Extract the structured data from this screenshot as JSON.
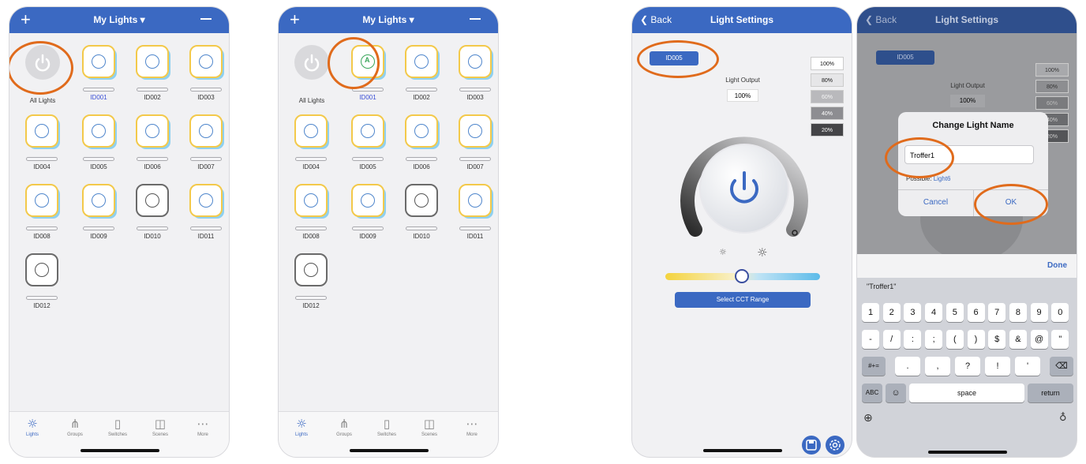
{
  "screens": [
    {
      "title": "My Lights",
      "all_label": "All Lights",
      "tiles": [
        "ID001",
        "ID002",
        "ID003",
        "ID004",
        "ID005",
        "ID006",
        "ID007",
        "ID008",
        "ID009",
        "ID010",
        "ID011",
        "ID012"
      ],
      "tabs": [
        "Lights",
        "Groups",
        "Switches",
        "Scenes",
        "More"
      ]
    },
    {
      "title": "My Lights",
      "all_label": "All Lights",
      "tiles": [
        "ID001",
        "ID002",
        "ID003",
        "ID004",
        "ID005",
        "ID006",
        "ID007",
        "ID008",
        "ID009",
        "ID010",
        "ID011",
        "ID012"
      ],
      "tabs": [
        "Lights",
        "Groups",
        "Switches",
        "Scenes",
        "More"
      ]
    }
  ],
  "settings": {
    "back": "Back",
    "title": "Light Settings",
    "light_id": "ID005",
    "output_label": "Light Output",
    "output_value": "100%",
    "percents": [
      "100%",
      "80%",
      "60%",
      "40%",
      "20%"
    ],
    "cct_button": "Select CCT Range"
  },
  "dialog": {
    "title": "Change Light Name",
    "input_value": "Troffer1",
    "possible_label": "Possible:",
    "possible_value": "Light6",
    "cancel": "Cancel",
    "ok": "OK",
    "done": "Done",
    "suggestion": "\"Troffer1\"",
    "row1": [
      "1",
      "2",
      "3",
      "4",
      "5",
      "6",
      "7",
      "8",
      "9",
      "0"
    ],
    "row2": [
      "-",
      "/",
      ":",
      ";",
      "(",
      ")",
      "$",
      "&",
      "@",
      "\""
    ],
    "row3": [
      ".",
      ",",
      "?",
      "!",
      "'"
    ],
    "key_symbols": "#+=",
    "key_abc": "ABC",
    "key_space": "space",
    "key_return": "return"
  },
  "colors": {
    "nav": "#3b69c2",
    "highlight": "#e06b1c"
  }
}
